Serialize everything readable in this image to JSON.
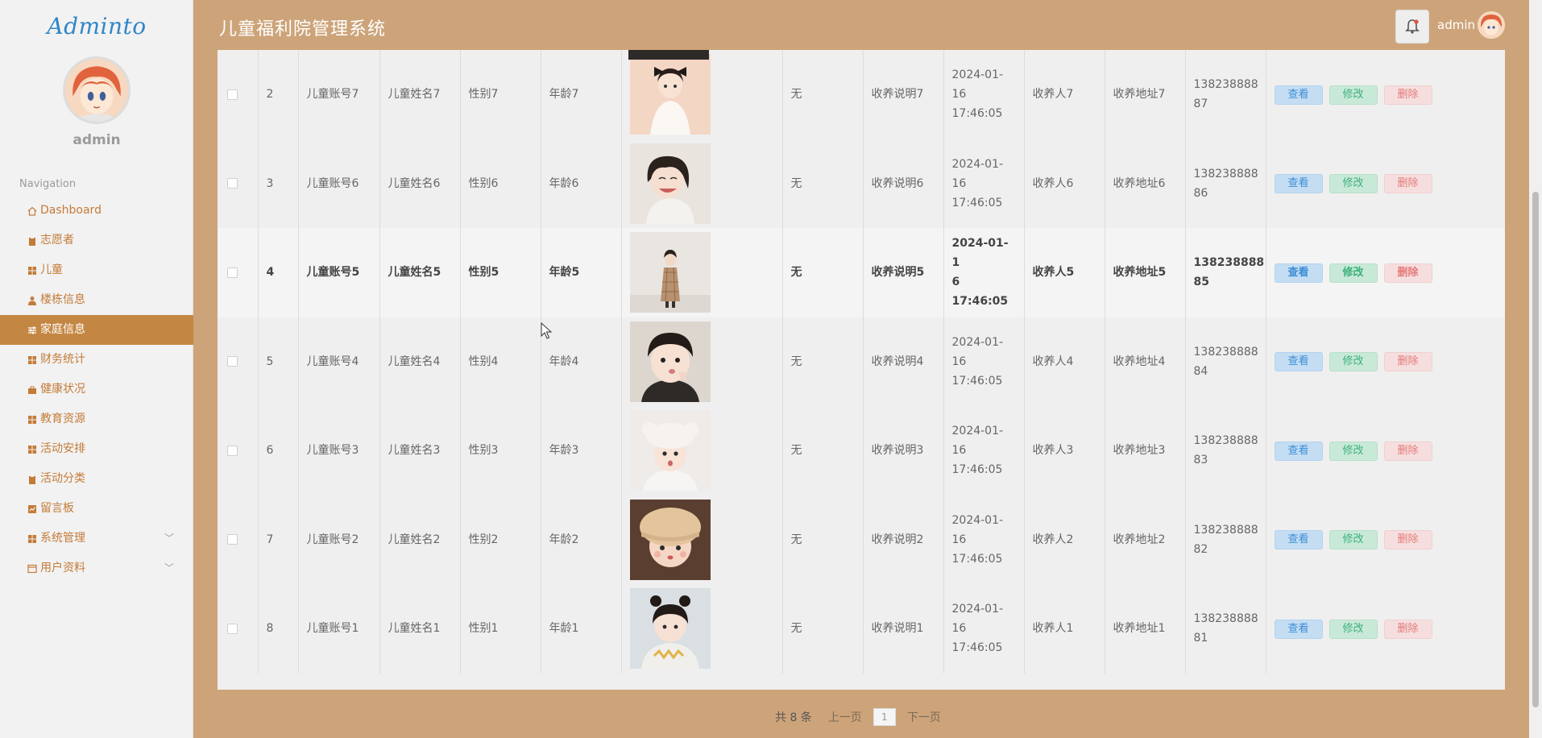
{
  "app": {
    "logo": "Adminto",
    "title": "儿童福利院管理系统"
  },
  "user": {
    "name": "admin"
  },
  "sidebar": {
    "heading": "Navigation",
    "items": [
      {
        "label": "Dashboard",
        "icon": "home-icon"
      },
      {
        "label": "志愿者",
        "icon": "clipboard-icon"
      },
      {
        "label": "儿童",
        "icon": "grid-icon"
      },
      {
        "label": "楼栋信息",
        "icon": "person-icon"
      },
      {
        "label": "家庭信息",
        "icon": "sliders-icon",
        "active": true
      },
      {
        "label": "财务统计",
        "icon": "grid-icon"
      },
      {
        "label": "健康状况",
        "icon": "briefcase-icon"
      },
      {
        "label": "教育资源",
        "icon": "grid-icon"
      },
      {
        "label": "活动安排",
        "icon": "grid-icon"
      },
      {
        "label": "活动分类",
        "icon": "clipboard-icon"
      },
      {
        "label": "留言板",
        "icon": "chart-icon"
      },
      {
        "label": "系统管理",
        "icon": "grid-icon",
        "expandable": true
      },
      {
        "label": "用户资料",
        "icon": "window-icon",
        "expandable": true
      }
    ]
  },
  "table": {
    "action_labels": {
      "view": "查看",
      "edit": "修改",
      "delete": "删除"
    },
    "rows": [
      {
        "index": "2",
        "account": "儿童账号7",
        "name": "儿童姓名7",
        "gender": "性别7",
        "age": "年龄7",
        "status": "无",
        "note": "收养说明7",
        "date": "2024-01-16",
        "time": "17:46:05",
        "adopter": "收养人7",
        "address": "收养地址7",
        "phone_a": "138238888",
        "phone_b": "87",
        "photo": "girl-bow-white-dress"
      },
      {
        "index": "3",
        "account": "儿童账号6",
        "name": "儿童姓名6",
        "gender": "性别6",
        "age": "年龄6",
        "status": "无",
        "note": "收养说明6",
        "date": "2024-01-16",
        "time": "17:46:05",
        "adopter": "收养人6",
        "address": "收养地址6",
        "phone_a": "138238888",
        "phone_b": "86",
        "photo": "girl-laughing"
      },
      {
        "index": "4",
        "account": "儿童账号5",
        "name": "儿童姓名5",
        "gender": "性别5",
        "age": "年龄5",
        "status": "无",
        "note": "收养说明5",
        "date": "2024-01-1",
        "time": "6 17:46:05",
        "adopter": "收养人5",
        "address": "收养地址5",
        "phone_a": "138238888",
        "phone_b": "85",
        "photo": "girl-plaid-coat",
        "bold": true
      },
      {
        "index": "5",
        "account": "儿童账号4",
        "name": "儿童姓名4",
        "gender": "性别4",
        "age": "年龄4",
        "status": "无",
        "note": "收养说明4",
        "date": "2024-01-16",
        "time": "17:46:05",
        "adopter": "收养人4",
        "address": "收养地址4",
        "phone_a": "138238888",
        "phone_b": "84",
        "photo": "girl-pouting"
      },
      {
        "index": "6",
        "account": "儿童账号3",
        "name": "儿童姓名3",
        "gender": "性别3",
        "age": "年龄3",
        "status": "无",
        "note": "收养说明3",
        "date": "2024-01-16",
        "time": "17:46:05",
        "adopter": "收养人3",
        "address": "收养地址3",
        "phone_a": "138238888",
        "phone_b": "83",
        "photo": "girl-white-hat"
      },
      {
        "index": "7",
        "account": "儿童账号2",
        "name": "儿童姓名2",
        "gender": "性别2",
        "age": "年龄2",
        "status": "无",
        "note": "收养说明2",
        "date": "2024-01-16",
        "time": "17:46:05",
        "adopter": "收养人2",
        "address": "收养地址2",
        "phone_a": "138238888",
        "phone_b": "82",
        "photo": "baby-beige-hat"
      },
      {
        "index": "8",
        "account": "儿童账号1",
        "name": "儿童姓名1",
        "gender": "性别1",
        "age": "年龄1",
        "status": "无",
        "note": "收养说明1",
        "date": "2024-01-16",
        "time": "17:46:05",
        "adopter": "收养人1",
        "address": "收养地址1",
        "phone_a": "138238888",
        "phone_b": "81",
        "photo": "girl-hair-buns"
      }
    ]
  },
  "pagination": {
    "total": "共 8 条",
    "prev": "上一页",
    "current": "1",
    "next": "下一页"
  },
  "colors": {
    "header": "#cda47a",
    "active_nav": "#c48743",
    "nav_text": "#c47b37",
    "logo": "#2f87c8"
  }
}
